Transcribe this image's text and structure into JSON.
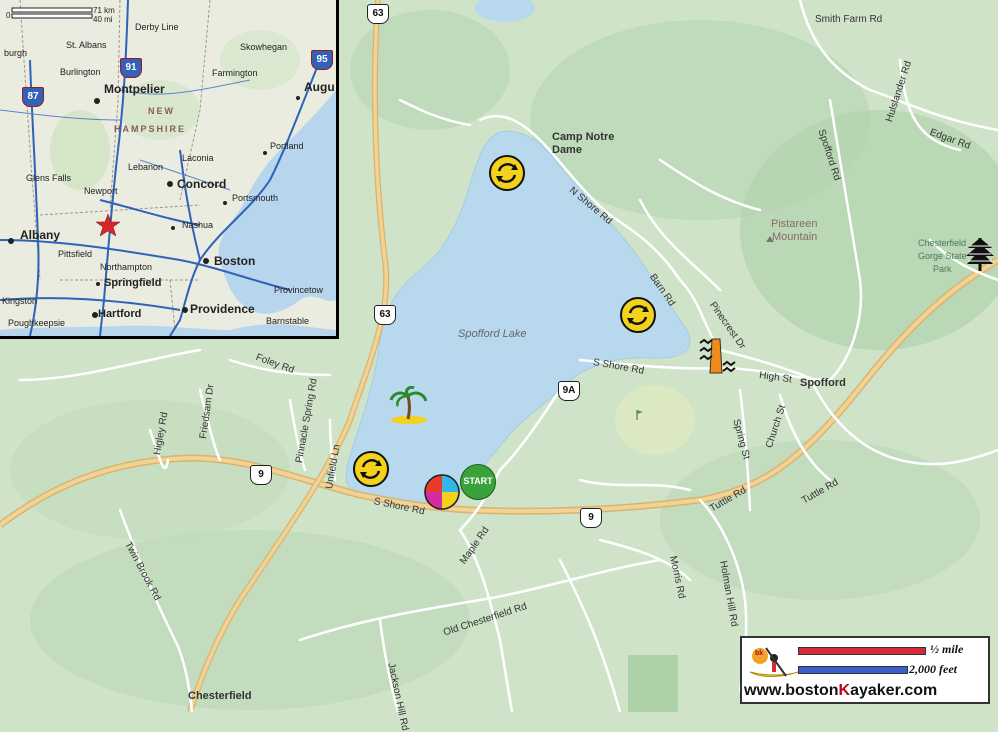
{
  "map": {
    "lake_name": "Spofford Lake",
    "towns": {
      "spofford": "Spofford",
      "chesterfield": "Chesterfield",
      "camp_notre_dame_1": "Camp Notre",
      "camp_notre_dame_2": "Dame"
    },
    "places": {
      "pistareen_1": "Pistareen",
      "pistareen_2": "Mountain",
      "gorge_1": "Chesterfield",
      "gorge_2": "Gorge State",
      "gorge_3": "Park"
    },
    "roads": {
      "smith_farm": "Smith Farm Rd",
      "hulslander": "Hulslander Rd",
      "edgar": "Edgar Rd",
      "spofford_rd": "Spofford Rd",
      "n_shore": "N Shore Rd",
      "barn": "Barn Rd",
      "pinecrest": "Pinecrest Dr",
      "high_st": "High St",
      "s_shore_east": "S Shore Rd",
      "s_shore_west": "S Shore Rd",
      "spring_st": "Spring St",
      "church_st": "Church St",
      "tuttle_1": "Tuttle Rd",
      "tuttle_2": "Tuttle Rd",
      "holman_hill": "Holman Hill Rd",
      "morris": "Morris Rd",
      "maple": "Maple Rd",
      "old_chesterfield": "Old Chesterfield Rd",
      "jackson_hill": "Jackson Hill Rd",
      "twin_brook": "Twin Brook Rd",
      "higley": "Higley Rd",
      "friedsam": "Friedsam Dr",
      "foley": "Foley Rd",
      "pinnacle_spring": "Pinnacle Spring Rd",
      "unfield": "Unfield Ln"
    },
    "shields": {
      "r63_north": "63",
      "r63_mid": "63",
      "r9a": "9A",
      "r9_west": "9",
      "r9_east": "9"
    },
    "markers": {
      "start": "START"
    }
  },
  "inset": {
    "scale_zero": "0",
    "scale_km": "71 km",
    "scale_mi": "40 mi",
    "state": "NEW HAMPSHIRE",
    "state_line1": "NEW",
    "state_line2": "HAMPSHIRE",
    "labels": {
      "derby_line": "Derby Line",
      "burgh": "burgh",
      "st_albans": "St. Albans",
      "skowhegan": "Skowhegan",
      "burlington": "Burlington",
      "farmington": "Farmington",
      "montpelier": "Montpelier",
      "augu": "Augu",
      "portland": "Portland",
      "laconia": "Laconia",
      "lebanon": "Lebanon",
      "glens_falls": "Glens Falls",
      "concord": "Concord",
      "newport": "Newport",
      "portsmouth": "Portsmouth",
      "albany": "Albany",
      "nashua": "Nashua",
      "pittsfield": "Pittsfield",
      "northampton": "Northampton",
      "boston": "Boston",
      "springfield": "Springfield",
      "provincetow": "Provincetow",
      "kingston": "Kingston",
      "hartford": "Hartford",
      "providence": "Providence",
      "barnstable": "Barnstable",
      "poughkeepsie": "Poughkeepsie"
    },
    "interstates": {
      "i91": "91",
      "i87": "87",
      "i95": "95"
    }
  },
  "logo": {
    "half_mile": "½ mile",
    "feet": "2,000 feet",
    "url_pre": "www.boston",
    "url_k": "K",
    "url_post": "ayaker.com",
    "badge": "bk"
  },
  "colors": {
    "water": "#b8d8ee",
    "land": "#cfe3c9",
    "highway": "#e9c98e",
    "road": "#ffffff",
    "marker_yellow": "#f2d21a",
    "start_green": "#3aa23a",
    "scale_red": "#d62a3a",
    "scale_blue": "#3a5ec8"
  }
}
